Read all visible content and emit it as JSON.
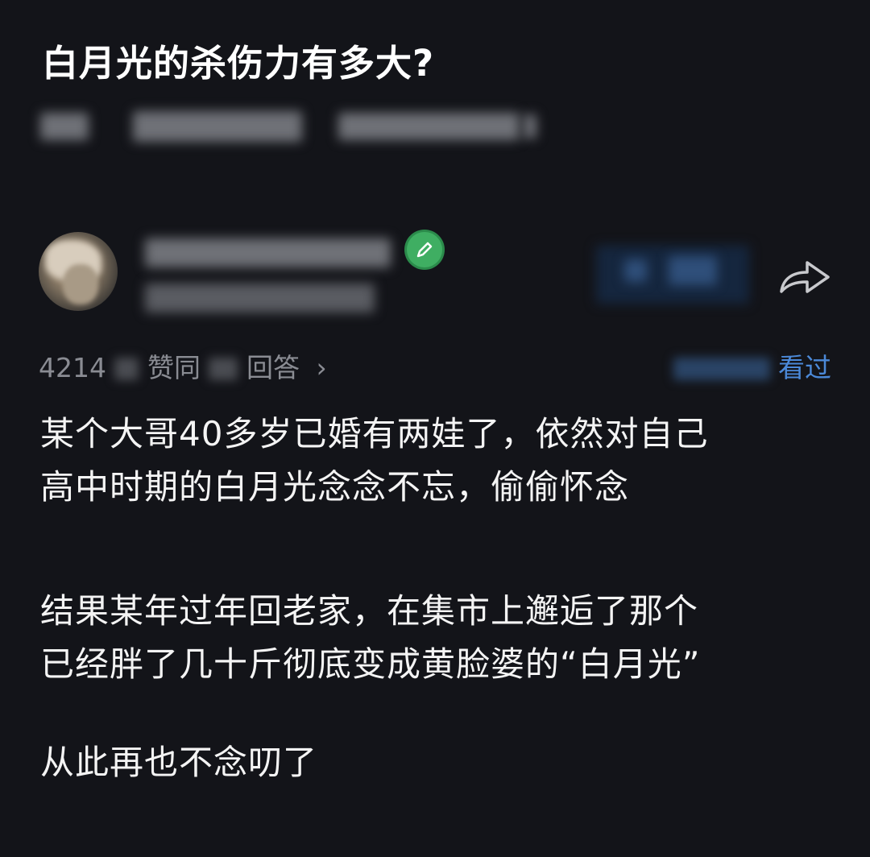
{
  "question": {
    "title": "白月光的杀伤力有多大?"
  },
  "author": {
    "meta_left_prefix": "4214",
    "meta_left_middle": "赞同",
    "meta_left_suffix": "回答",
    "meta_right": "看过"
  },
  "answer": {
    "paragraphs": [
      {
        "lines": [
          "某个大哥40多岁已婚有两娃了，依然对自己",
          "高中时期的白月光念念不忘，偷偷怀念"
        ]
      },
      {
        "lines": [
          "结果某年过年回老家，在集市上邂逅了那个",
          "已经胖了几十斤彻底变成黄脸婆的“白月光”"
        ]
      },
      {
        "lines": [
          "从此再也不念叨了"
        ]
      }
    ]
  },
  "icons": {
    "badge": "verified-pen-icon",
    "share": "share-arrow-icon",
    "chevron": "chevron-right-icon"
  },
  "colors": {
    "background": "#131419",
    "badge": "#3fae62",
    "link": "#4b89d8",
    "muted": "#8a8c93"
  }
}
